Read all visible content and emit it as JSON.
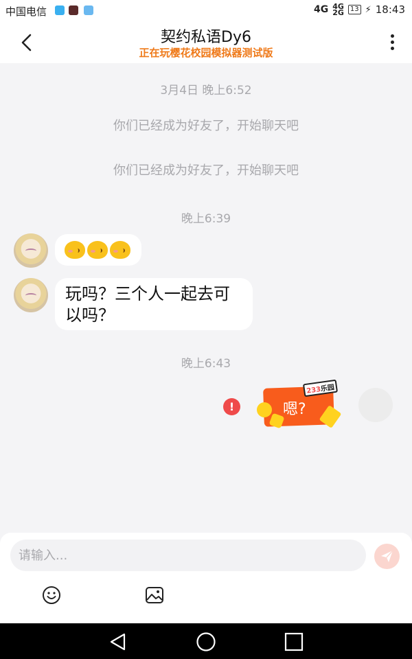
{
  "status_bar": {
    "carrier": "中国电信",
    "network": "4G",
    "network_small_top": "4G",
    "network_small_bottom": "2G",
    "battery": "13",
    "time": "18:43"
  },
  "header": {
    "title": "契约私语Dy6",
    "subtitle": "正在玩樱花校园模拟器测试版"
  },
  "messages": [
    {
      "type": "timestamp",
      "text": "3月4日 晚上6:52"
    },
    {
      "type": "system",
      "text": "你们已经成为好友了，开始聊天吧"
    },
    {
      "type": "system",
      "text": "你们已经成为好友了，开始聊天吧"
    },
    {
      "type": "timestamp",
      "text": "晚上6:39"
    },
    {
      "type": "incoming",
      "content": "emoji",
      "emoji_count": 3
    },
    {
      "type": "incoming",
      "content": "text",
      "line1": "玩吗？三个人一起去可",
      "line2": "以吗？"
    },
    {
      "type": "timestamp",
      "text": "晚上6:43"
    },
    {
      "type": "outgoing",
      "content": "sticker",
      "sticker_text": "嗯?",
      "sticker_logo_num": "233",
      "sticker_logo_text": "乐园",
      "status": "failed",
      "status_icon": "!"
    }
  ],
  "composer": {
    "placeholder": "请输入..."
  },
  "icons": {
    "back": "chevron-left-icon",
    "more": "more-vertical-icon",
    "send": "send-icon",
    "emoji": "smiley-icon",
    "image": "image-icon",
    "nav_back": "triangle-back-icon",
    "nav_home": "circle-home-icon",
    "nav_recent": "square-recent-icon"
  },
  "colors": {
    "subtitle": "#ef7a1a",
    "error": "#ef4a4a",
    "send_button": "#fbd6cf",
    "background": "#f4f4f6"
  }
}
